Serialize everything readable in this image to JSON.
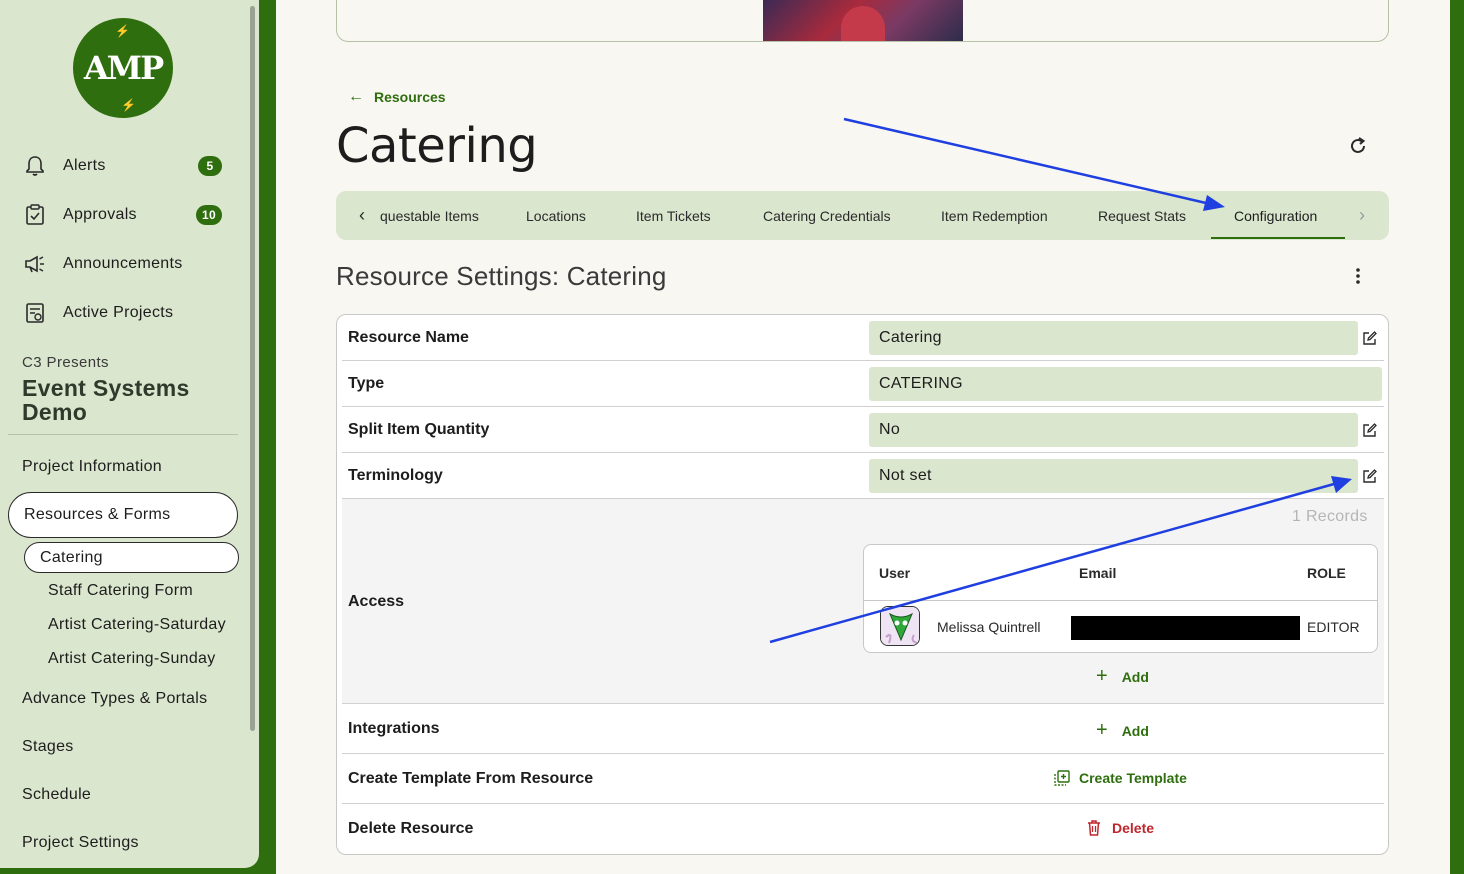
{
  "sidebar": {
    "logo_text": "AMP",
    "nav": [
      {
        "label": "Alerts",
        "icon": "bell-icon",
        "badge": "5"
      },
      {
        "label": "Approvals",
        "icon": "clipboard-check-icon",
        "badge": "10"
      },
      {
        "label": "Announcements",
        "icon": "megaphone-icon"
      },
      {
        "label": "Active Projects",
        "icon": "project-list-icon"
      }
    ],
    "project_org": "C3 Presents",
    "project_name": "Event Systems Demo",
    "menu": {
      "project_information": "Project Information",
      "resources_forms": "Resources & Forms",
      "catering": "Catering",
      "sub_items": [
        "Staff Catering Form",
        "Artist Catering-Saturday",
        "Artist Catering-Sunday"
      ],
      "advance_types": "Advance Types & Portals",
      "stages": "Stages",
      "schedule": "Schedule",
      "project_settings": "Project Settings"
    }
  },
  "header": {
    "back_label": "Resources",
    "title": "Catering"
  },
  "tabs": [
    {
      "label": "questable Items"
    },
    {
      "label": "Locations"
    },
    {
      "label": "Item Tickets"
    },
    {
      "label": "Catering Credentials"
    },
    {
      "label": "Item Redemption"
    },
    {
      "label": "Request Stats"
    },
    {
      "label": "Configuration",
      "active": true
    }
  ],
  "settings": {
    "title": "Resource Settings: Catering",
    "rows": {
      "resource_name": {
        "label": "Resource Name",
        "value": "Catering"
      },
      "type": {
        "label": "Type",
        "value": "CATERING"
      },
      "split": {
        "label": "Split Item Quantity",
        "value": "No"
      },
      "terminology": {
        "label": "Terminology",
        "value": "Not set"
      },
      "access": {
        "label": "Access"
      },
      "integrations": {
        "label": "Integrations"
      },
      "template": {
        "label": "Create Template From Resource"
      },
      "delete": {
        "label": "Delete Resource"
      }
    },
    "access": {
      "records": "1 Records",
      "columns": {
        "user": "User",
        "email": "Email",
        "role": "ROLE"
      },
      "users": [
        {
          "name": "Melissa Quintrell",
          "role": "EDITOR"
        }
      ],
      "add_label": "Add"
    },
    "integrations_add": "Add",
    "create_template_label": "Create Template",
    "delete_label": "Delete"
  },
  "colors": {
    "brand_green": "#2f6e0f",
    "sidebar_bg": "#dbe6ce",
    "delete_red": "#c0262d",
    "annotation_arrow": "#1f3fe0"
  }
}
